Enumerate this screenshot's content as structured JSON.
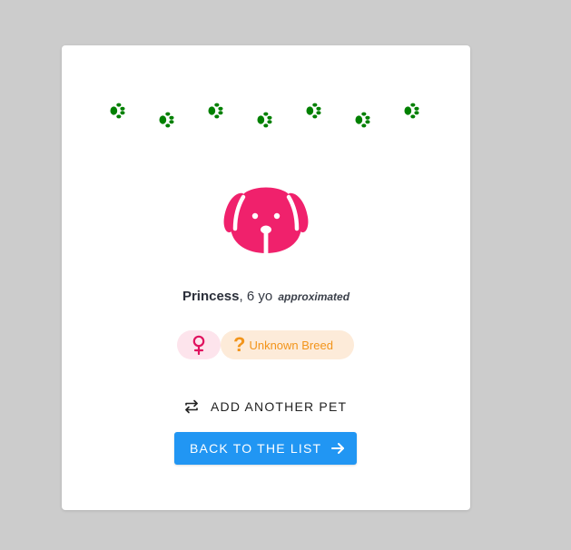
{
  "pet": {
    "name": "Princess",
    "age_text": ", 6 yo",
    "age_note": "approximated",
    "gender_symbol": "♀",
    "breed_symbol": "?",
    "breed_label": "Unknown Breed"
  },
  "actions": {
    "add_another_label": "ADD ANOTHER PET",
    "back_label": "BACK TO THE LIST"
  },
  "colors": {
    "background": "#cccccc",
    "paw": "#008000",
    "dog": "#f0216c",
    "gender_chip_bg": "#fde4ec",
    "breed_chip_bg": "#fdebd9",
    "breed_text": "#f2941a",
    "primary_button": "#2196f3"
  },
  "icons": {
    "decoration": "paw-print-icon",
    "avatar": "dog-face-icon",
    "gender": "female-icon",
    "breed": "question-mark-icon",
    "add": "repeat-arrows-icon",
    "back": "arrow-right-icon"
  }
}
